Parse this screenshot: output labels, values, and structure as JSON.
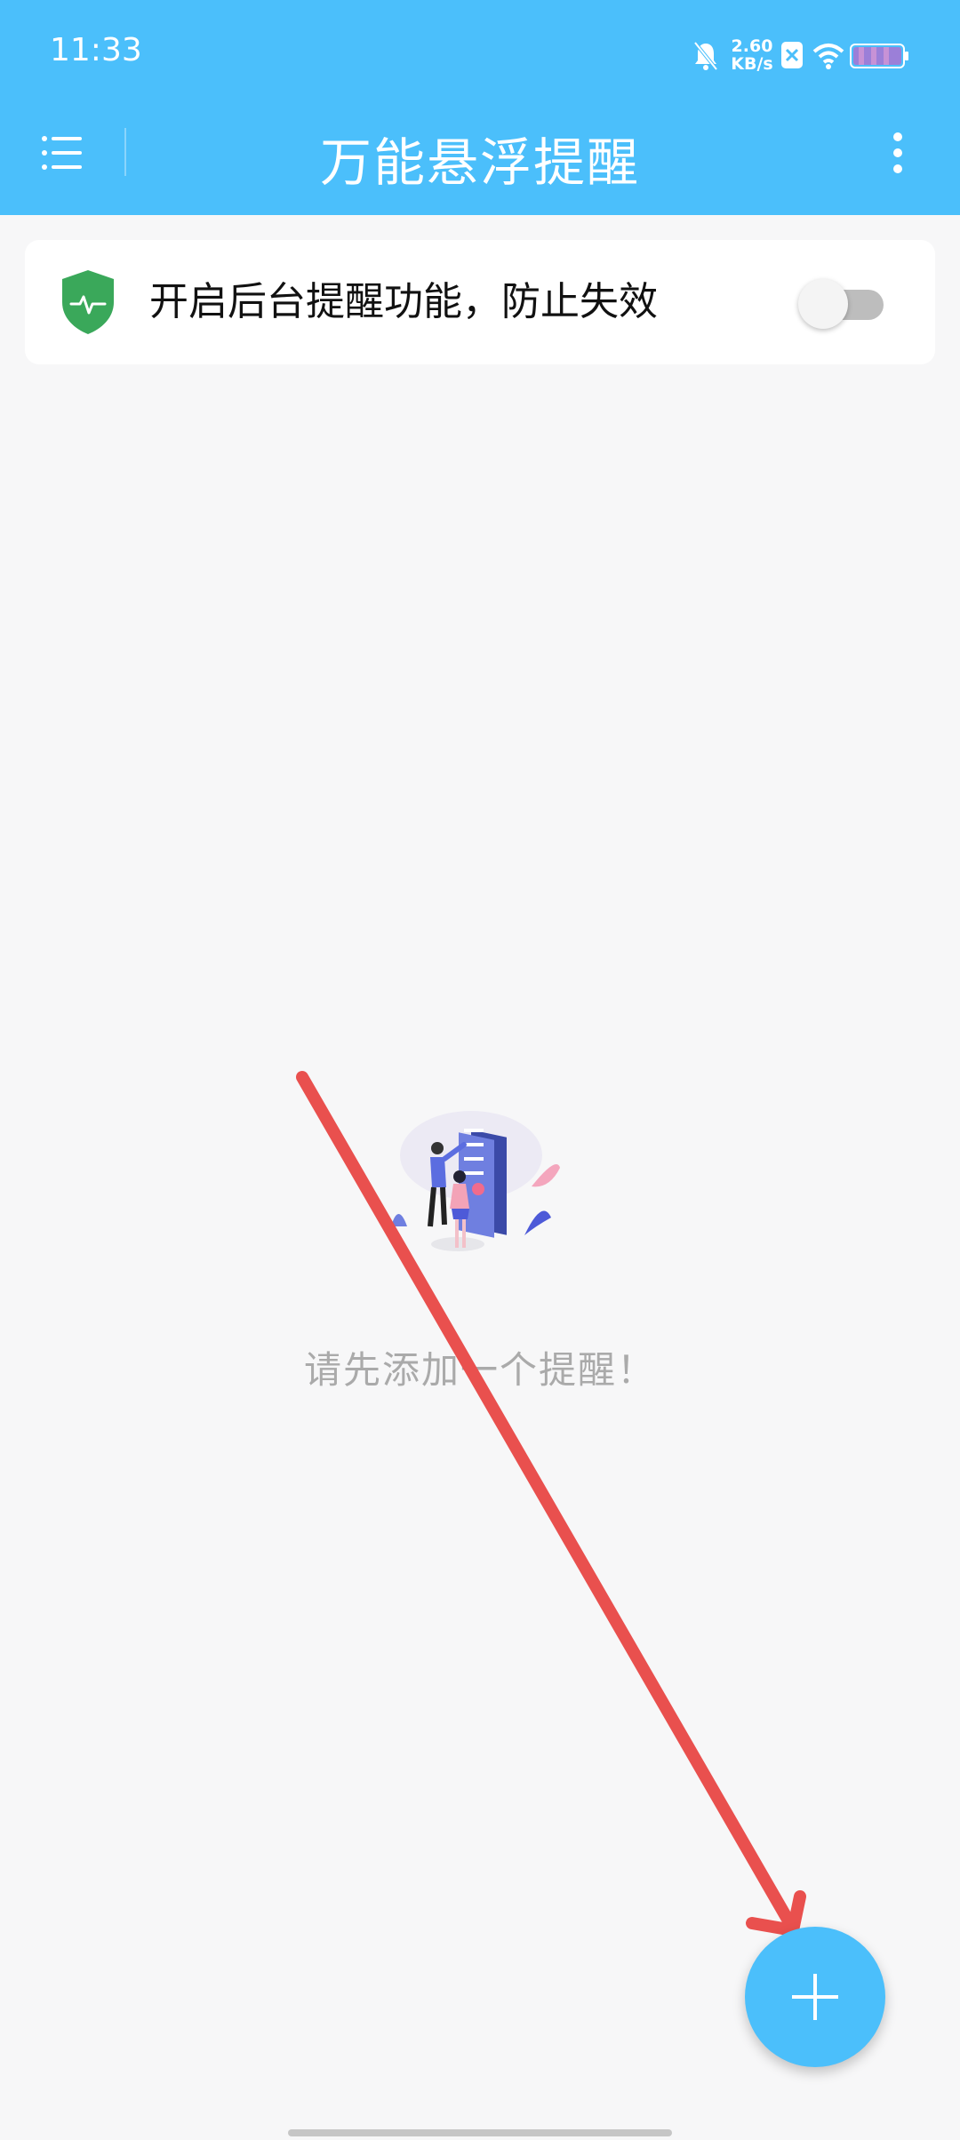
{
  "status_bar": {
    "time": "11:33",
    "net_speed_value": "2.60",
    "net_speed_unit": "KB/s",
    "icons": [
      "mute-bell-icon",
      "close-badge-icon",
      "wifi-icon",
      "battery-icon"
    ]
  },
  "app_bar": {
    "title": "万能悬浮提醒",
    "menu_icon": "menu-icon",
    "more_icon": "more-vert-icon",
    "color": "#4bbffb"
  },
  "background_card": {
    "label": "开启后台提醒功能，防止失效",
    "icon": "shield-icon",
    "toggle_on": false,
    "shield_color": "#3aa85a"
  },
  "empty_state": {
    "message": "请先添加一个提醒！",
    "illustration": "people-checklist-illustration"
  },
  "fab": {
    "icon": "plus-icon"
  },
  "overlay": {
    "annotation": "red-arrow",
    "color": "#e9504e"
  }
}
